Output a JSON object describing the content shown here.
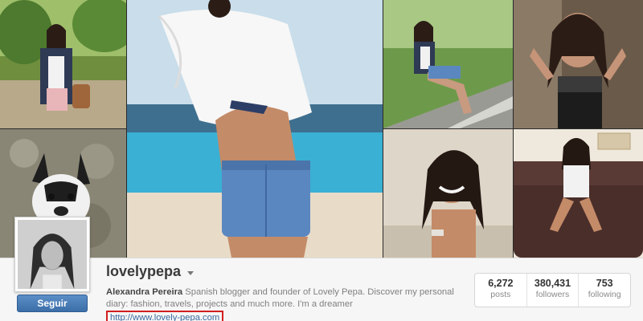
{
  "profile": {
    "username": "lovelypepa",
    "full_name": "Alexandra Pereira",
    "bio_line1": " Spanish blogger and founder of Lovely Pepa. Discover my personal",
    "bio_line2": "diary: fashion, travels, projects and much more. I'm a dreamer",
    "website": "http://www.lovely-pepa.com",
    "follow_label": "Seguir",
    "avatar_icon": "profile-photo"
  },
  "stats": [
    {
      "value": "6,272",
      "label": "posts"
    },
    {
      "value": "380,431",
      "label": "followers"
    },
    {
      "value": "753",
      "label": "following"
    }
  ],
  "colors": {
    "link": "#3b6aa0",
    "highlight": "#d11f1f",
    "button": "#4a7db7"
  }
}
